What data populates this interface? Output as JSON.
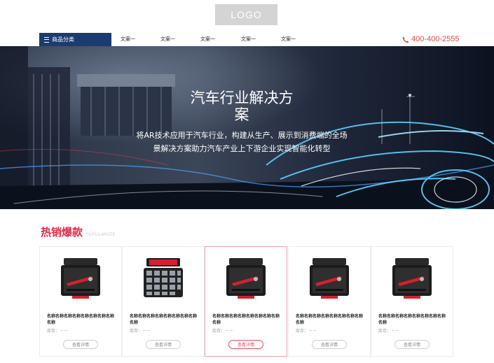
{
  "header": {
    "logo_text": "LOGO"
  },
  "nav": {
    "category_label": "商品分类",
    "links": [
      "文案一",
      "文案一",
      "文案一",
      "文案一",
      "文案一"
    ],
    "phone": "400-400-2555",
    "phone_color": "#e24848"
  },
  "banner": {
    "title_line1": "汽车行业解决方",
    "title_line2": "案",
    "subtitle_line1": "将AR技术应用于汽车行业，构建从生产、展示到消费端的全场",
    "subtitle_line2": "景解决方案助力汽车产业上下游企业实现智能化转型"
  },
  "hot": {
    "title": "热销爆款",
    "subtitle": "POPULARIZE",
    "accent_color": "#e02e4c"
  },
  "products": [
    {
      "name": "名称名称名称名称名称名称名称名称名称",
      "stock": "库存：－－",
      "button": "查看详情",
      "thumb": "red-tool-case-icon",
      "active": false
    },
    {
      "name": "名称名称名称名称名称名称名称名称名称",
      "stock": "库存：－－",
      "button": "查看详情",
      "thumb": "parts-kit-icon",
      "active": false
    },
    {
      "name": "名称名称名称名称名称名称名称名称名称",
      "stock": "库存：－－",
      "button": "查看详情",
      "thumb": "red-tool-case-icon",
      "active": true
    },
    {
      "name": "名称名称名称名称名称名称名称名称名称",
      "stock": "库存：－－",
      "button": "查看详情",
      "thumb": "red-tool-case-icon",
      "active": false
    },
    {
      "name": "名称名称名称名称名称名称名称名称名称",
      "stock": "库存：－－",
      "button": "查看详情",
      "thumb": "red-tool-case-icon",
      "active": false
    }
  ]
}
